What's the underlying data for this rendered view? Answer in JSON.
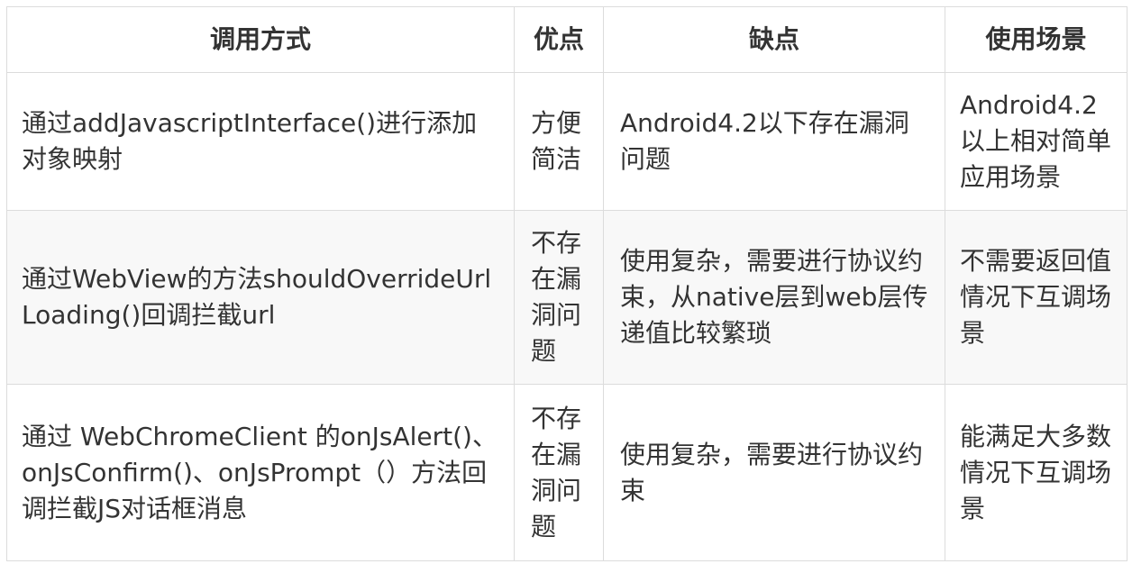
{
  "table": {
    "headers": [
      "调用方式",
      "优点",
      "缺点",
      "使用场景"
    ],
    "rows": [
      {
        "method": "通过addJavascriptInterface()进行添加对象映射",
        "pros": "方便简洁",
        "cons": "Android4.2以下存在漏洞问题",
        "scenario": "Android4.2以上相对简单应用场景"
      },
      {
        "method": "通过WebView的方法shouldOverrideUrlLoading()回调拦截url",
        "pros": "不存在漏洞问题",
        "cons": "使用复杂，需要进行协议约束，从native层到web层传递值比较繁琐",
        "scenario": "不需要返回值情况下互调场景"
      },
      {
        "method": "通过 WebChromeClient 的onJsAlert()、onJsConfirm()、onJsPrompt（）方法回调拦截JS对话框消息",
        "pros": "不存在漏洞问题",
        "cons": "使用复杂，需要进行协议约束",
        "scenario": "能满足大多数情况下互调场景"
      }
    ]
  },
  "colors": {
    "border": "#dcdcdc",
    "text": "#333333",
    "row_alt_bg": "#f8f8f8"
  }
}
